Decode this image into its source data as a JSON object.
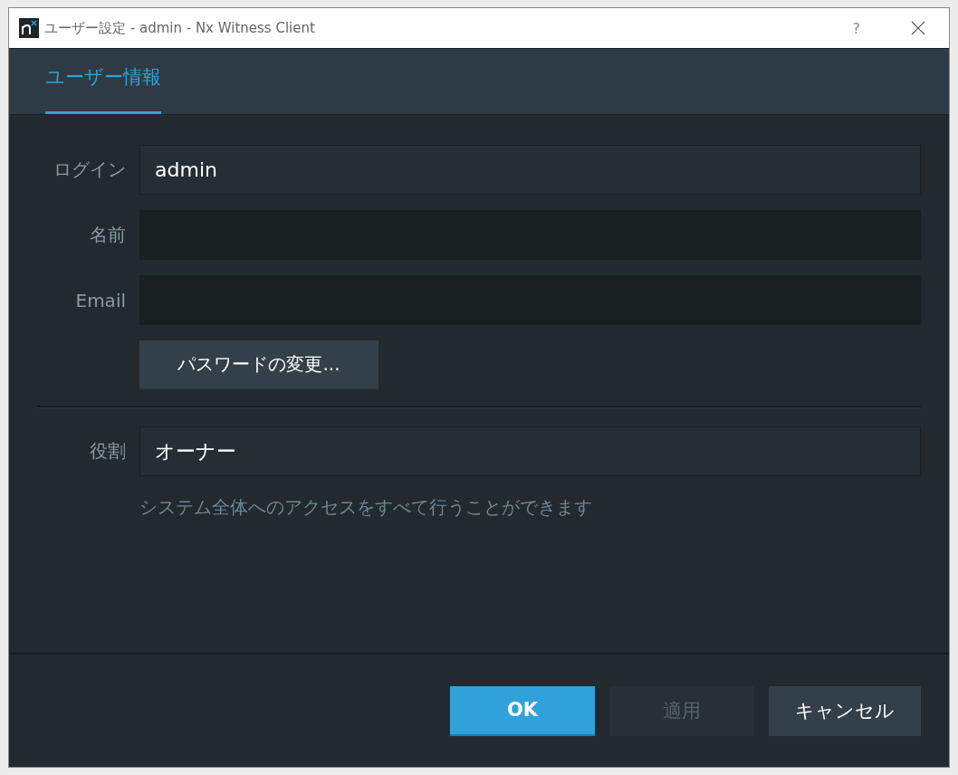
{
  "window": {
    "title": "ユーザー設定 - admin - Nx Witness Client",
    "help": "?"
  },
  "tabs": [
    {
      "label": "ユーザー情報",
      "selected": true
    }
  ],
  "fields": [
    {
      "label": "ログイン",
      "value": "admin",
      "kind": "readonly"
    },
    {
      "label": "名前",
      "kind": "input"
    },
    {
      "label": "Email",
      "kind": "input"
    }
  ],
  "change_password_button": "パスワードの変更...",
  "role": {
    "label": "役割",
    "value": "オーナー"
  },
  "role_description": "システム全体へのアクセスをすべて行うことができます",
  "buttons": [
    {
      "label": "OK",
      "kind": "primary",
      "disabled": false
    },
    {
      "label": "適用",
      "kind": "normal",
      "disabled": true
    },
    {
      "label": "キャンセル",
      "kind": "normal",
      "disabled": false
    }
  ]
}
